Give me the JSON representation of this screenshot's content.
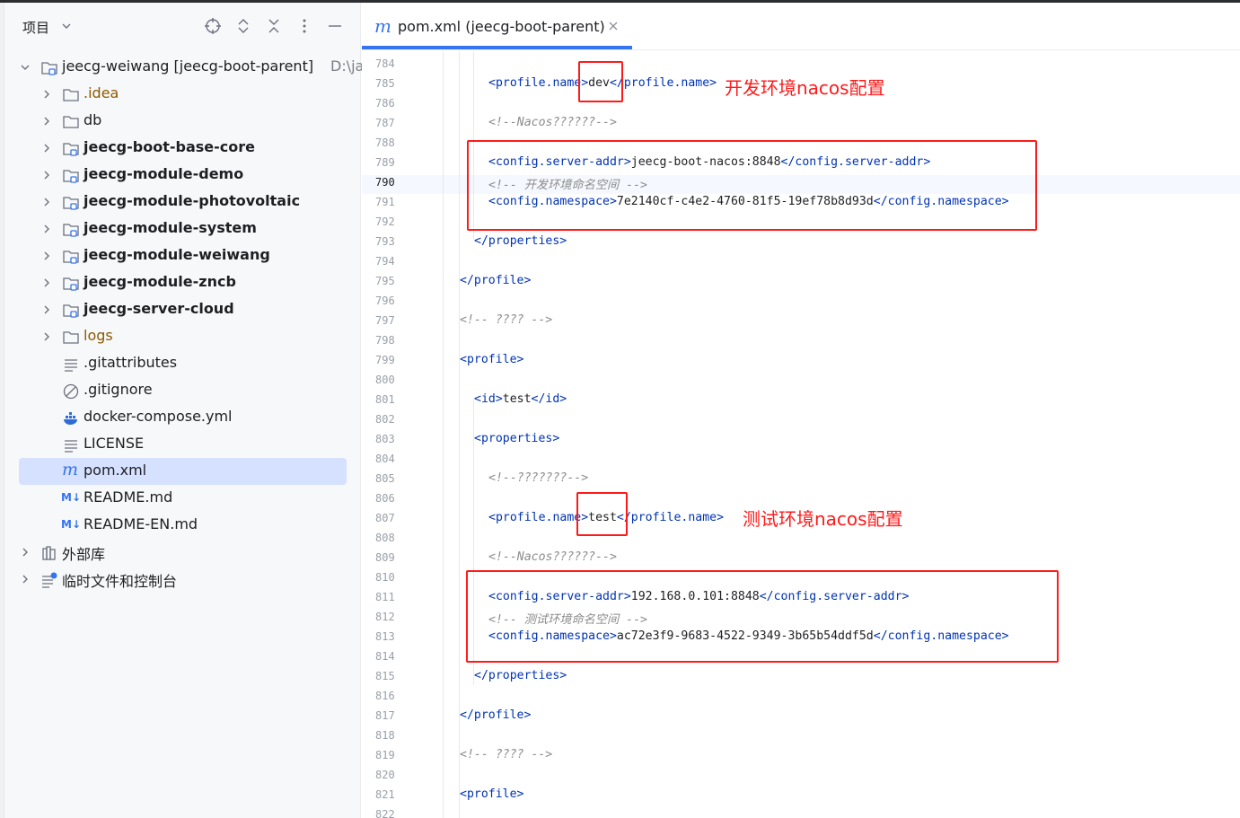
{
  "project_panel": {
    "title": "项目",
    "tree": [
      {
        "label": "jeecg-weiwang [jeecg-boot-parent]",
        "path": "D:\\ja",
        "type": "module-root",
        "expanded": true
      },
      {
        "label": ".idea",
        "type": "folder"
      },
      {
        "label": "db",
        "type": "folder"
      },
      {
        "label": "jeecg-boot-base-core",
        "type": "module"
      },
      {
        "label": "jeecg-module-demo",
        "type": "module"
      },
      {
        "label": "jeecg-module-photovoltaic",
        "type": "module"
      },
      {
        "label": "jeecg-module-system",
        "type": "module"
      },
      {
        "label": "jeecg-module-weiwang",
        "type": "module"
      },
      {
        "label": "jeecg-module-zncb",
        "type": "module"
      },
      {
        "label": "jeecg-server-cloud",
        "type": "module"
      },
      {
        "label": "logs",
        "type": "folder-excluded"
      },
      {
        "label": ".gitattributes",
        "type": "text-file"
      },
      {
        "label": ".gitignore",
        "type": "ignore-file"
      },
      {
        "label": "docker-compose.yml",
        "type": "docker-file"
      },
      {
        "label": "LICENSE",
        "type": "text-file"
      },
      {
        "label": "pom.xml",
        "type": "maven-file",
        "selected": true
      },
      {
        "label": "README.md",
        "type": "markdown-file"
      },
      {
        "label": "README-EN.md",
        "type": "markdown-file"
      },
      {
        "label": "外部库",
        "type": "libraries"
      },
      {
        "label": "临时文件和控制台",
        "type": "scratches"
      }
    ]
  },
  "editor": {
    "tab": {
      "icon": "m",
      "label": "pom.xml (jeecg-boot-parent)"
    },
    "current_line": "790",
    "lines": [
      {
        "n": "784",
        "parts": []
      },
      {
        "n": "785",
        "parts": [
          [
            "tag",
            "<profile.name>"
          ],
          [
            "text",
            "dev"
          ],
          [
            "tag",
            "</profile.name>"
          ]
        ]
      },
      {
        "n": "786",
        "parts": []
      },
      {
        "n": "787",
        "parts": [
          [
            "comment",
            "<!--Nacos??????-->"
          ]
        ]
      },
      {
        "n": "788",
        "parts": []
      },
      {
        "n": "789",
        "parts": [
          [
            "tag",
            "<config.server-addr>"
          ],
          [
            "text",
            "jeecg-boot-nacos:8848"
          ],
          [
            "tag",
            "</config.server-addr>"
          ]
        ]
      },
      {
        "n": "790",
        "parts": [
          [
            "comment",
            "<!-- 开发环境命名空间 -->"
          ]
        ]
      },
      {
        "n": "791",
        "parts": [
          [
            "tag",
            "<config.namespace>"
          ],
          [
            "text",
            "7e2140cf-c4e2-4760-81f5-19ef78b8d93d"
          ],
          [
            "tag",
            "</config.namespace>"
          ]
        ]
      },
      {
        "n": "792",
        "parts": []
      },
      {
        "n": "793",
        "parts": [
          [
            "tag",
            "</properties>"
          ]
        ]
      },
      {
        "n": "794",
        "parts": []
      },
      {
        "n": "795",
        "parts": [
          [
            "tag",
            "</profile>"
          ]
        ]
      },
      {
        "n": "796",
        "parts": []
      },
      {
        "n": "797",
        "parts": [
          [
            "comment",
            "<!-- ???? -->"
          ]
        ]
      },
      {
        "n": "798",
        "parts": []
      },
      {
        "n": "799",
        "parts": [
          [
            "tag",
            "<profile>"
          ]
        ]
      },
      {
        "n": "800",
        "parts": []
      },
      {
        "n": "801",
        "parts": [
          [
            "tag",
            "<id>"
          ],
          [
            "text",
            "test"
          ],
          [
            "tag",
            "</id>"
          ]
        ]
      },
      {
        "n": "802",
        "parts": []
      },
      {
        "n": "803",
        "parts": [
          [
            "tag",
            "<properties>"
          ]
        ]
      },
      {
        "n": "804",
        "parts": []
      },
      {
        "n": "805",
        "parts": [
          [
            "comment",
            "<!--???????-->"
          ]
        ]
      },
      {
        "n": "806",
        "parts": []
      },
      {
        "n": "807",
        "parts": [
          [
            "tag",
            "<profile.name>"
          ],
          [
            "text",
            "test"
          ],
          [
            "tag",
            "</profile.name>"
          ]
        ]
      },
      {
        "n": "808",
        "parts": []
      },
      {
        "n": "809",
        "parts": [
          [
            "comment",
            "<!--Nacos??????-->"
          ]
        ]
      },
      {
        "n": "810",
        "parts": []
      },
      {
        "n": "811",
        "parts": [
          [
            "tag",
            "<config.server-addr>"
          ],
          [
            "text",
            "192.168.0.101:8848"
          ],
          [
            "tag",
            "</config.server-addr>"
          ]
        ]
      },
      {
        "n": "812",
        "parts": [
          [
            "comment",
            "<!-- 测试环境命名空间 -->"
          ]
        ]
      },
      {
        "n": "813",
        "parts": [
          [
            "tag",
            "<config.namespace>"
          ],
          [
            "text",
            "ac72e3f9-9683-4522-9349-3b65b54ddf5d"
          ],
          [
            "tag",
            "</config.namespace>"
          ]
        ]
      },
      {
        "n": "814",
        "parts": []
      },
      {
        "n": "815",
        "parts": [
          [
            "tag",
            "</properties>"
          ]
        ]
      },
      {
        "n": "816",
        "parts": []
      },
      {
        "n": "817",
        "parts": [
          [
            "tag",
            "</profile>"
          ]
        ]
      },
      {
        "n": "818",
        "parts": []
      },
      {
        "n": "819",
        "parts": [
          [
            "comment",
            "<!-- ???? -->"
          ]
        ]
      },
      {
        "n": "820",
        "parts": []
      },
      {
        "n": "821",
        "parts": [
          [
            "tag",
            "<profile>"
          ]
        ]
      },
      {
        "n": "822",
        "parts": []
      }
    ]
  },
  "annotations": {
    "dev": "开发环境nacos配置",
    "test": "测试环境nacos配置"
  },
  "colors": {
    "accent": "#3574f0",
    "xml_tag": "#0033b3",
    "comment": "#8c8c8c",
    "annotation": "#ff1a1a",
    "selection": "#d5e1ff"
  }
}
